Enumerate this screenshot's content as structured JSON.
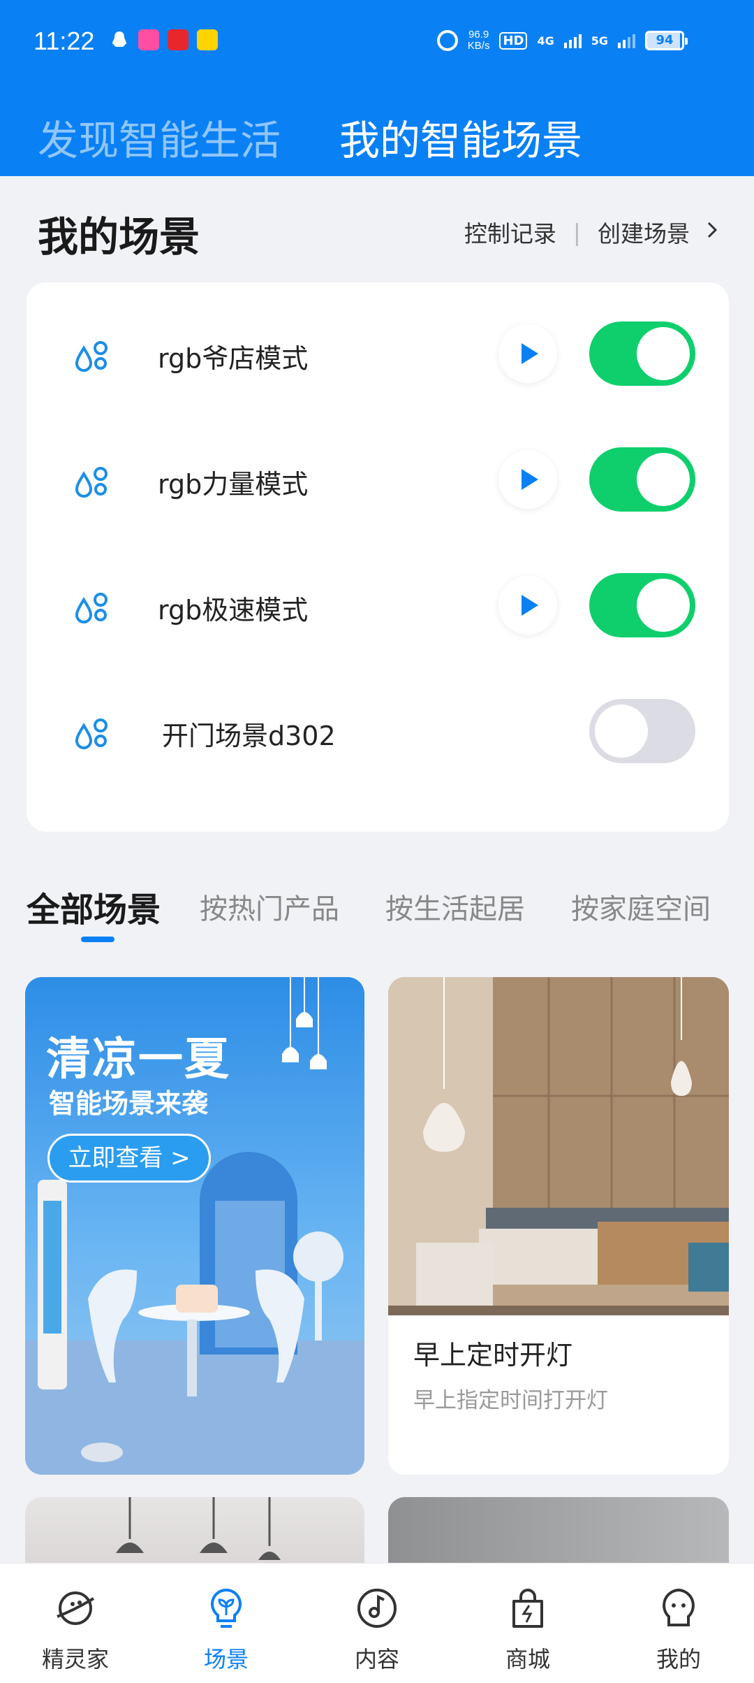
{
  "status_bar": {
    "time": "11:22",
    "net_speed_value": "96.9",
    "net_speed_unit": "KB/s",
    "hd": "HD",
    "sim_label_4g": "4G",
    "sim_label_5g": "5G",
    "battery": "94",
    "app_icons": [
      "qq-icon",
      "lala-icon",
      "red-app-icon",
      "yellow-app-icon"
    ]
  },
  "header": {
    "tab_discover": "发现智能生活",
    "tab_mine": "我的智能场景",
    "bg_color": "#0a80f5"
  },
  "my_scenes": {
    "title": "我的场景",
    "control_log": "控制记录",
    "create_scene": "创建场景",
    "items": [
      {
        "name": "rgb爷店模式",
        "has_play": true,
        "enabled": true
      },
      {
        "name": "rgb力量模式",
        "has_play": true,
        "enabled": true
      },
      {
        "name": "rgb极速模式",
        "has_play": true,
        "enabled": true
      },
      {
        "name": "开门场景d302",
        "has_play": false,
        "enabled": false
      }
    ]
  },
  "categories": {
    "tabs": [
      "全部场景",
      "按热门产品",
      "按生活起居",
      "按家庭空间"
    ],
    "active": "全部场景"
  },
  "cards": {
    "promo": {
      "title": "清凉一夏",
      "subtitle": "智能场景来袭",
      "button": "立即查看 >"
    },
    "scene_card": {
      "title": "早上定时开灯",
      "description": "早上指定时间打开灯"
    }
  },
  "bottom_nav": {
    "items": [
      {
        "label": "精灵家",
        "icon": "planet-icon"
      },
      {
        "label": "场景",
        "icon": "bulb-leaf-icon"
      },
      {
        "label": "内容",
        "icon": "music-note-icon"
      },
      {
        "label": "商城",
        "icon": "shopping-bag-icon"
      },
      {
        "label": "我的",
        "icon": "face-icon"
      }
    ],
    "active": "场景",
    "accent": "#0a80f5"
  },
  "colors": {
    "toggle_on": "#0ecf6c",
    "toggle_off": "#dcdce4",
    "accent": "#0a80f5"
  }
}
